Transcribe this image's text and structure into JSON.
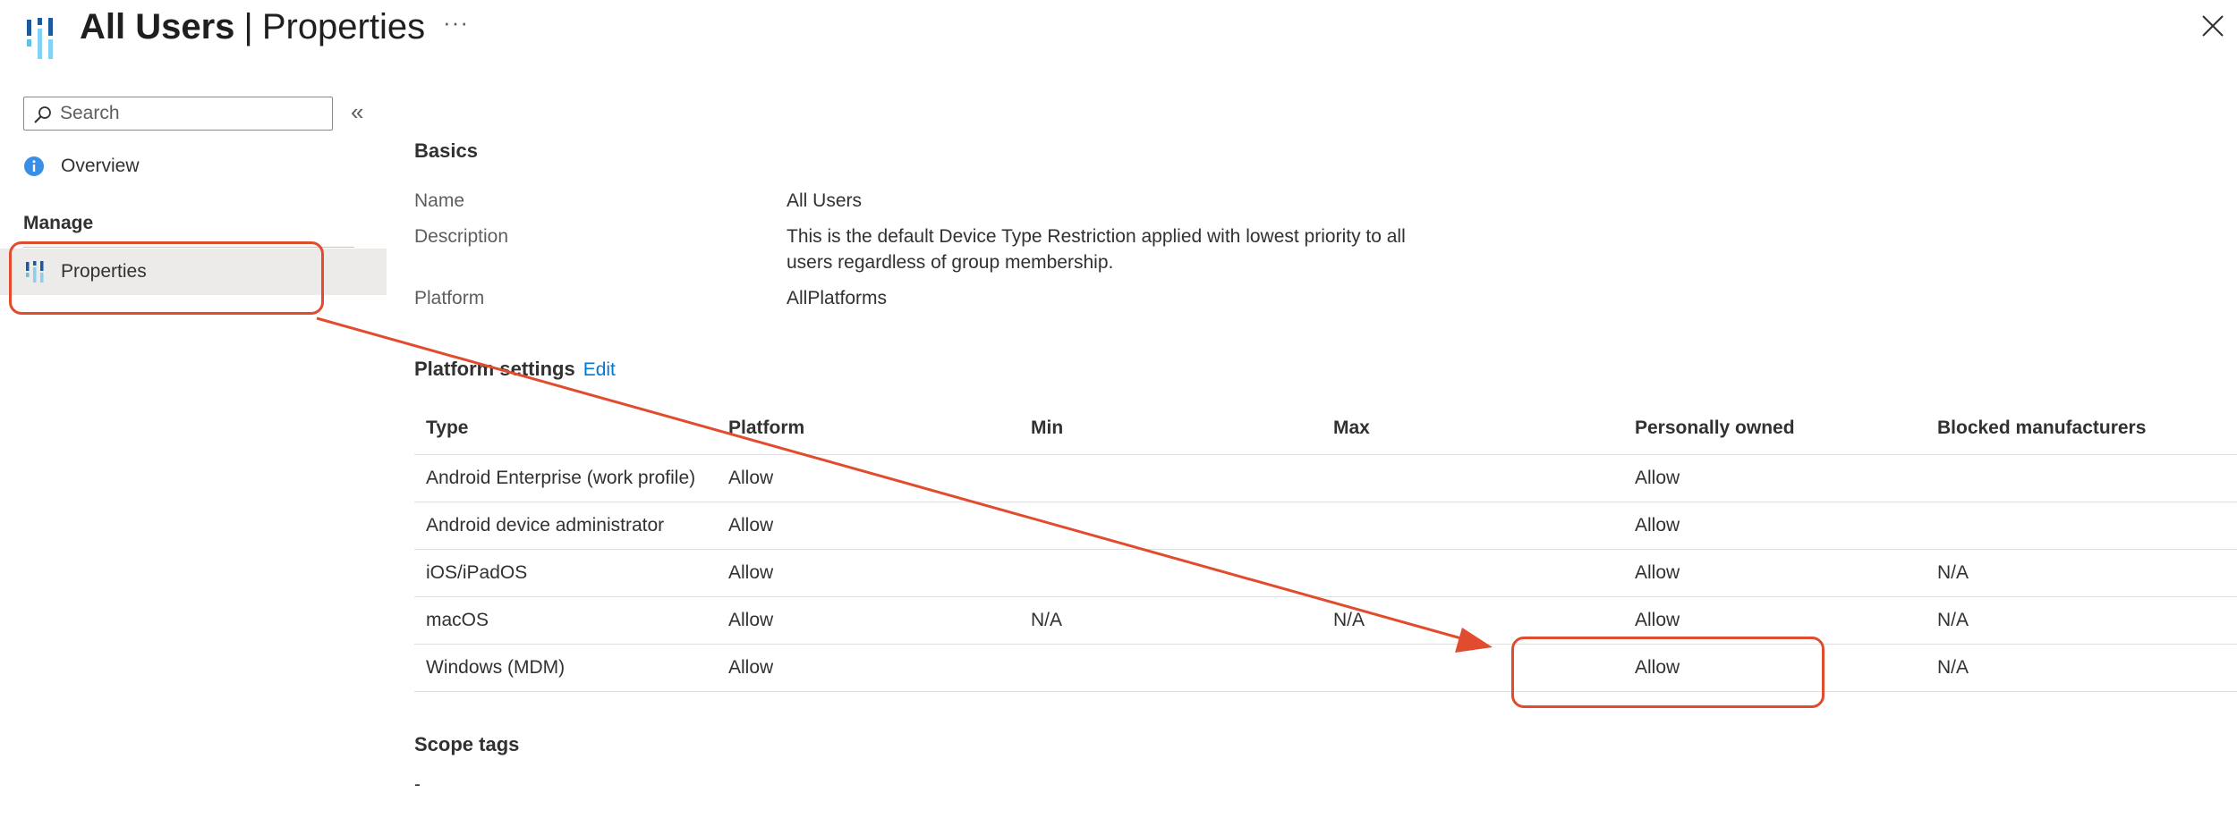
{
  "header": {
    "title": "All Users",
    "separator": "|",
    "subtitle": "Properties",
    "more_label": "···"
  },
  "sidebar": {
    "search_placeholder": "Search",
    "collapse_label": "«",
    "overview_label": "Overview",
    "manage_label": "Manage",
    "properties_label": "Properties"
  },
  "basics": {
    "heading": "Basics",
    "name_label": "Name",
    "name_value": "All Users",
    "description_label": "Description",
    "description_line1": "This is the default Device Type Restriction applied with lowest priority to all",
    "description_line2": "users regardless of group membership.",
    "platform_label": "Platform",
    "platform_value": "AllPlatforms"
  },
  "platform_settings": {
    "heading": "Platform settings",
    "edit_label": "Edit",
    "columns": [
      "Type",
      "Platform",
      "Min",
      "Max",
      "Personally owned",
      "Blocked manufacturers"
    ],
    "rows": [
      [
        "Android Enterprise (work profile)",
        "Allow",
        "",
        "",
        "Allow",
        ""
      ],
      [
        "Android device administrator",
        "Allow",
        "",
        "",
        "Allow",
        ""
      ],
      [
        "iOS/iPadOS",
        "Allow",
        "",
        "",
        "Allow",
        "N/A"
      ],
      [
        "macOS",
        "Allow",
        "N/A",
        "N/A",
        "Allow",
        "N/A"
      ],
      [
        "Windows (MDM)",
        "Allow",
        "",
        "",
        "Allow",
        "N/A"
      ]
    ]
  },
  "scope_tags": {
    "heading": "Scope tags",
    "value": "-"
  },
  "colors": {
    "accent": "#0078d4",
    "annotation": "#e24c2e",
    "selected_nav_bg": "#edebe9"
  }
}
